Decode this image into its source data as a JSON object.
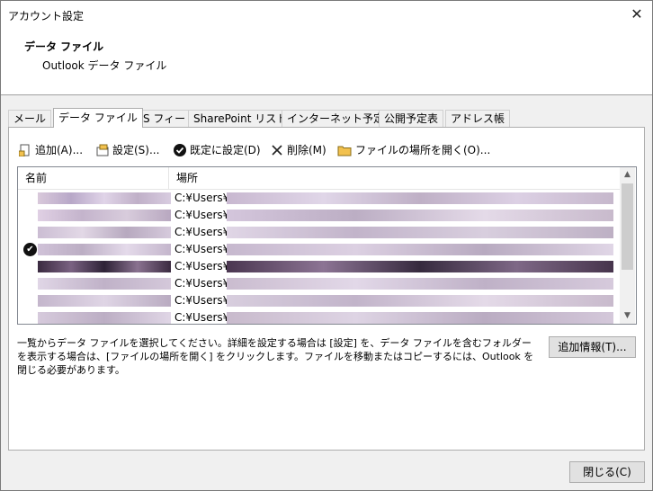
{
  "window": {
    "title": "アカウント設定",
    "close_glyph": "✕"
  },
  "header": {
    "title": "データ ファイル",
    "subtitle": "Outlook データ ファイル"
  },
  "tabs": [
    {
      "label": "メール"
    },
    {
      "label": "データ ファイル",
      "active": true
    },
    {
      "label": "RSS フィード"
    },
    {
      "label": "SharePoint リスト"
    },
    {
      "label": "インターネット予定表"
    },
    {
      "label": "公開予定表"
    },
    {
      "label": "アドレス帳"
    }
  ],
  "toolbar": {
    "add": "追加(A)...",
    "settings": "設定(S)...",
    "set_default": "既定に設定(D)",
    "delete": "削除(M)",
    "open_location": "ファイルの場所を開く(O)..."
  },
  "list": {
    "columns": [
      "名前",
      "場所"
    ],
    "rows": [
      {
        "location": "C:¥Users¥",
        "is_default": false
      },
      {
        "location": "C:¥Users¥",
        "is_default": false
      },
      {
        "location": "C:¥Users¥",
        "is_default": false
      },
      {
        "location": "C:¥Users¥",
        "is_default": true
      },
      {
        "location": "C:¥Users¥",
        "is_default": false
      },
      {
        "location": "C:¥Users¥",
        "is_default": false
      },
      {
        "location": "C:¥Users¥",
        "is_default": false
      },
      {
        "location": "C:¥Users¥",
        "is_default": false
      }
    ],
    "default_mark": "✔"
  },
  "description": "一覧からデータ ファイルを選択してください。詳細を設定する場合は [設定] を、データ ファイルを含むフォルダーを表示する場合は、[ファイルの場所を開く] をクリックします。ファイルを移動またはコピーするには、Outlook を閉じる必要があります。",
  "buttons": {
    "more_info": "追加情報(T)...",
    "close": "閉じる(C)"
  },
  "colors": {
    "redacted_blur": "#c8b8c8",
    "redacted_dark": "#3a2a40"
  }
}
